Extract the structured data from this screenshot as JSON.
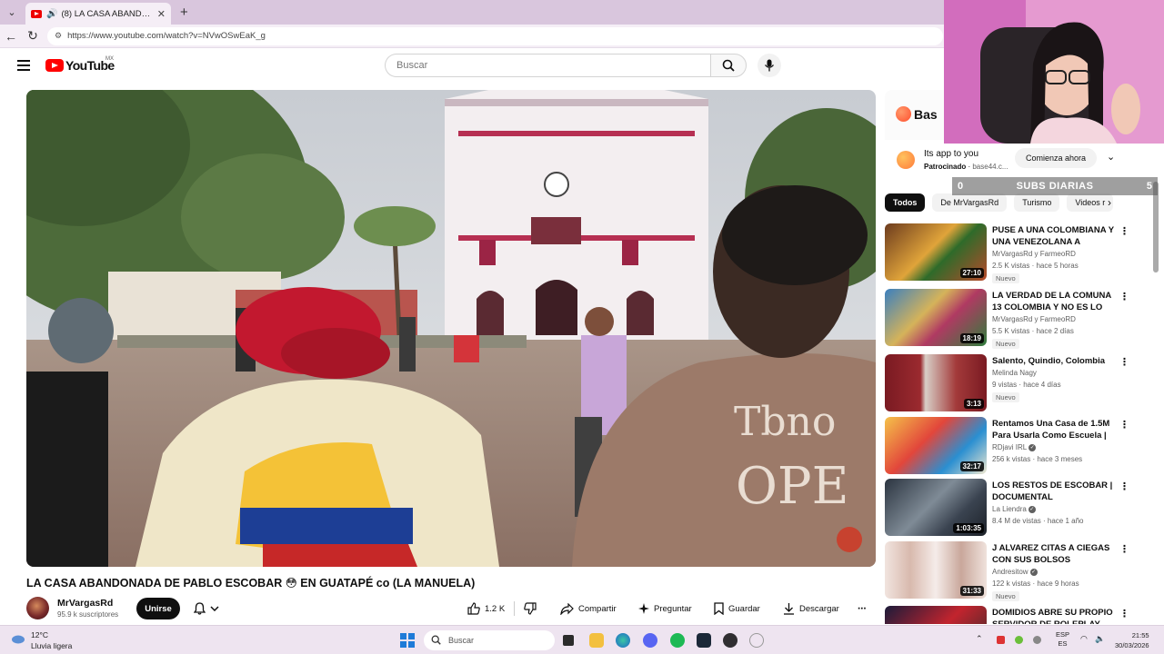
{
  "browser": {
    "tab_title": "(8) LA CASA ABANDONADA D",
    "url": "https://www.youtube.com/watch?v=NVwOSwEaK_g"
  },
  "youtube": {
    "logo_text": "YouTube",
    "region": "MX",
    "search_placeholder": "Buscar"
  },
  "video": {
    "title": "LA CASA ABANDONADA DE PABLO ESCOBAR 😳 EN GUATAPÉ co (LA MANUELA)",
    "channel": "MrVargasRd",
    "subscribers": "95.9 k suscriptores",
    "join_label": "Unirse",
    "likes": "1.2 K",
    "share_label": "Compartir",
    "ask_label": "Preguntar",
    "save_label": "Guardar",
    "download_label": "Descargar"
  },
  "ad": {
    "brand": "Bas",
    "title": "Its app to you",
    "sponsored": "Patrocinado",
    "domain": "base44.c...",
    "cta": "Comienza ahora"
  },
  "chips": [
    "Todos",
    "De MrVargasRd",
    "Turismo",
    "Videos r"
  ],
  "recommendations": [
    {
      "title": "PUSE A UNA COLOMBIANA Y UNA VENEZOLANA A COCINA...",
      "channel": "MrVargasRd y FarmeoRD",
      "meta": "2.5 K vistas · hace 5 horas",
      "badge": "Nuevo",
      "duration": "27:10"
    },
    {
      "title": "LA VERDAD DE LA COMUNA 13 COLOMBIA Y NO ES LO QUE ...",
      "channel": "MrVargasRd y FarmeoRD",
      "meta": "5.5 K vistas · hace 2 días",
      "badge": "Nuevo",
      "duration": "18:19"
    },
    {
      "title": "Salento, Quindio, Colombia",
      "channel": "Melinda Nagy",
      "meta": "9 vistas · hace 4 días",
      "badge": "Nuevo",
      "duration": "3:13"
    },
    {
      "title": "Rentamos Una Casa de 1.5M Para Usarla Como Escuela | Dí...",
      "channel": "RDjavi IRL",
      "meta": "256 k vistas · hace 3 meses",
      "badge": "",
      "duration": "32:17"
    },
    {
      "title": "LOS RESTOS DE ESCOBAR | DOCUMENTAL",
      "channel": "La Liendra",
      "meta": "8.4 M de vistas · hace 1 año",
      "badge": "",
      "duration": "1:03:35"
    },
    {
      "title": "J ALVAREZ CITAS A CIEGAS CON SUS BOLSOS",
      "channel": "Andresitow",
      "meta": "122 k vistas · hace 9 horas",
      "badge": "Nuevo",
      "duration": "31:33"
    },
    {
      "title": "DOMIDIOS ABRE SU PROPIO SERVIDOR DE ROLEPLAY...",
      "channel": "",
      "meta": "",
      "badge": "",
      "duration": ""
    }
  ],
  "overlay": {
    "subs_left": "0",
    "subs_label": "SUBS DIARIAS",
    "subs_right": "5"
  },
  "taskbar": {
    "temperature": "12°C",
    "weather": "Lluvia ligera",
    "search": "Buscar",
    "lang_1": "ESP",
    "lang_2": "ES",
    "time": "21:55",
    "date": "30/03/2026"
  },
  "colors": {
    "accent": "#ff0000",
    "tabbar": "#d9c6dd",
    "taskbar": "#eee4f0"
  }
}
